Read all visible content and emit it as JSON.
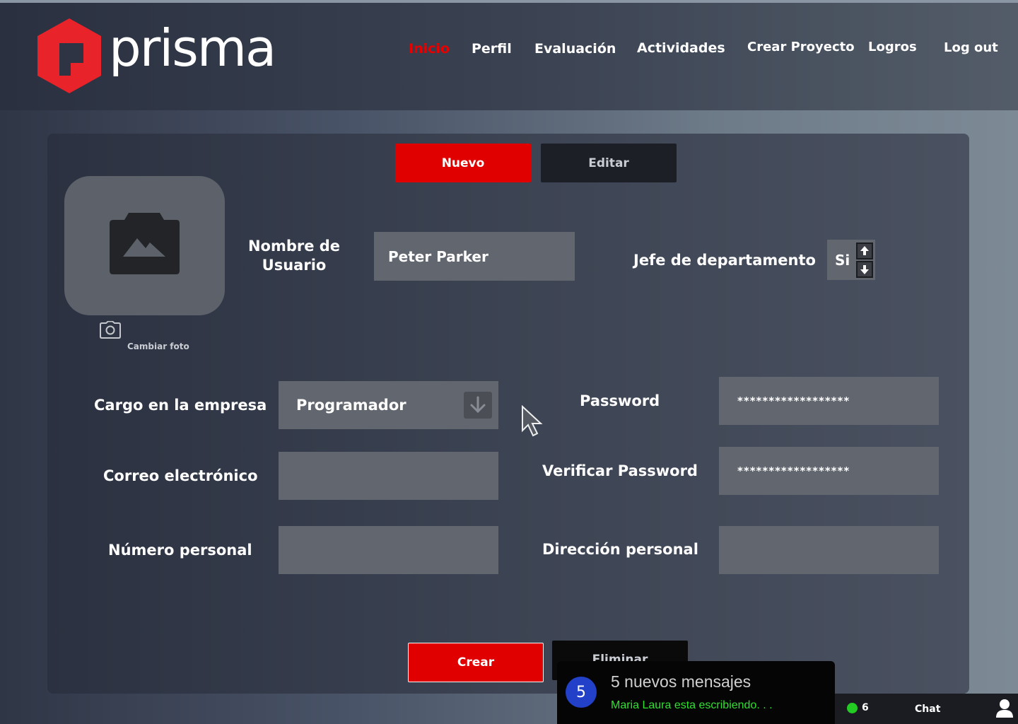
{
  "app": {
    "brand": "prisma"
  },
  "nav": {
    "items": [
      "Inicio",
      "Perfil",
      "Evaluación",
      "Actividades",
      "Crear Proyecto",
      "Logros",
      "Log out"
    ]
  },
  "form": {
    "tabs": {
      "new": "Nuevo",
      "edit": "Editar"
    },
    "photo": {
      "change_label": "Cambiar foto"
    },
    "username": {
      "label": "Nombre de Usuario",
      "value": "Peter Parker"
    },
    "department_head": {
      "label": "Jefe de departamento",
      "value": "Si"
    },
    "position": {
      "label": "Cargo en la empresa",
      "value": "Programador"
    },
    "password": {
      "label": "Password",
      "value": "******************"
    },
    "verify_password": {
      "label": "Verificar Password",
      "value": "******************"
    },
    "email": {
      "label": "Correo electrónico",
      "value": ""
    },
    "phone": {
      "label": "Número personal",
      "value": ""
    },
    "address": {
      "label": "Dirección personal",
      "value": ""
    },
    "actions": {
      "create": "Crear",
      "delete": "Eliminar"
    }
  },
  "chat": {
    "notification_count": "5",
    "notification_title": "5 nuevos mensajes",
    "typing_status": "Maria Laura esta escribiendo. . .",
    "online_count": "6",
    "label": "Chat"
  },
  "colors": {
    "accent": "#e10000",
    "online": "#22cc22",
    "typing": "#2fe02f",
    "badge": "#2240c8"
  }
}
